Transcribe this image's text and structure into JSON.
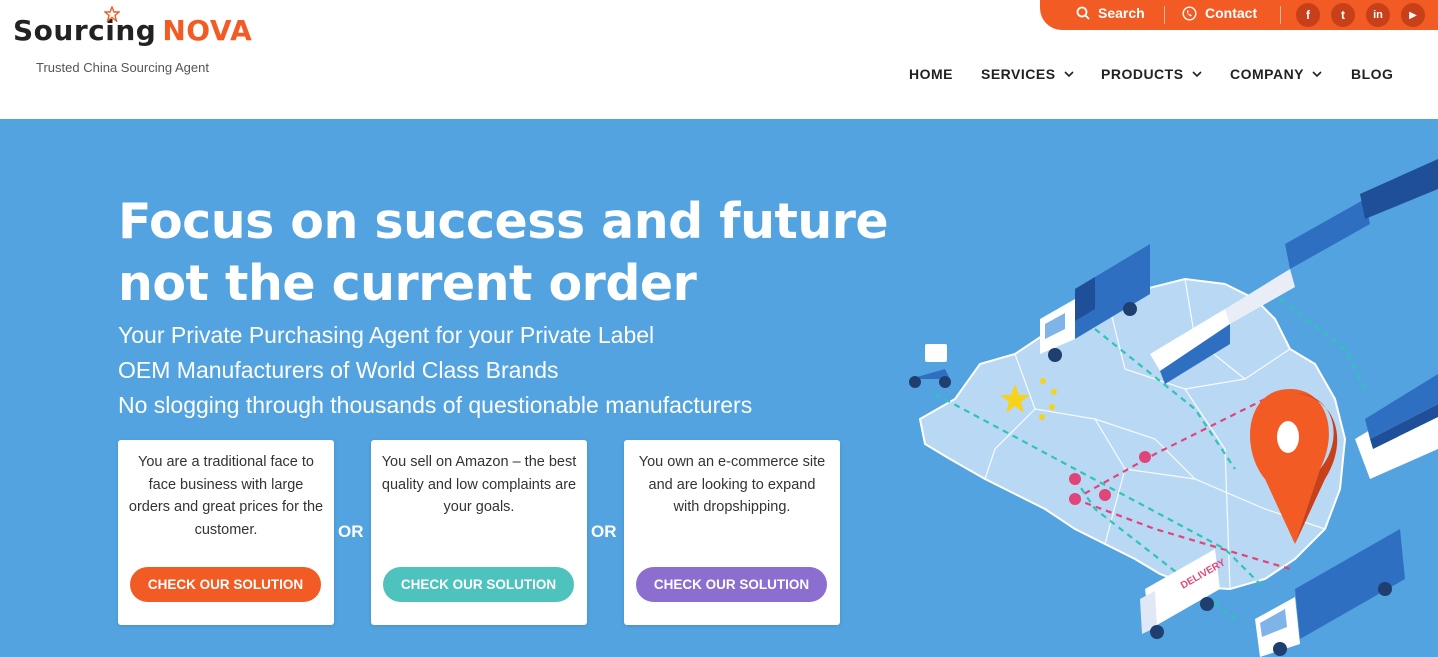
{
  "brand": {
    "name_part1": "Sourcing",
    "name_part2": "NOVA",
    "tagline": "Trusted China Sourcing Agent",
    "accent": "#f25c24"
  },
  "topbar": {
    "search_label": "Search",
    "contact_label": "Contact",
    "social": [
      {
        "icon": "facebook-icon",
        "glyph": "f"
      },
      {
        "icon": "twitter-icon",
        "glyph": "t"
      },
      {
        "icon": "linkedin-icon",
        "glyph": "in"
      },
      {
        "icon": "youtube-icon",
        "glyph": "▶"
      }
    ]
  },
  "nav": {
    "home": "HOME",
    "services": "SERVICES",
    "products": "PRODUCTS",
    "company": "COMPANY",
    "blog": "BLOG"
  },
  "hero": {
    "bg": "#53a3e0",
    "headline_line1": "Focus on success and future",
    "headline_line2": "not the current order",
    "sub1": "Your Private Purchasing Agent for your Private Label",
    "sub2": "OEM Manufacturers of World Class Brands",
    "sub3": "No slogging through thousands of questionable manufacturers",
    "or_label": "OR",
    "cards": [
      {
        "text": "You are a traditional face to face business with large orders and great prices for the customer.",
        "button": "CHECK OUR SOLUTION",
        "button_color": "#f25c24"
      },
      {
        "text": "You sell on Amazon – the best quality and low complaints are your goals.",
        "button": "CHECK OUR SOLUTION",
        "button_color": "#4ec3bd"
      },
      {
        "text": "You own an e-commerce site and are looking to expand with dropshipping.",
        "button": "CHECK OUR SOLUTION",
        "button_color": "#8c6dd0"
      }
    ],
    "illustration_label": "DELIVERY"
  }
}
